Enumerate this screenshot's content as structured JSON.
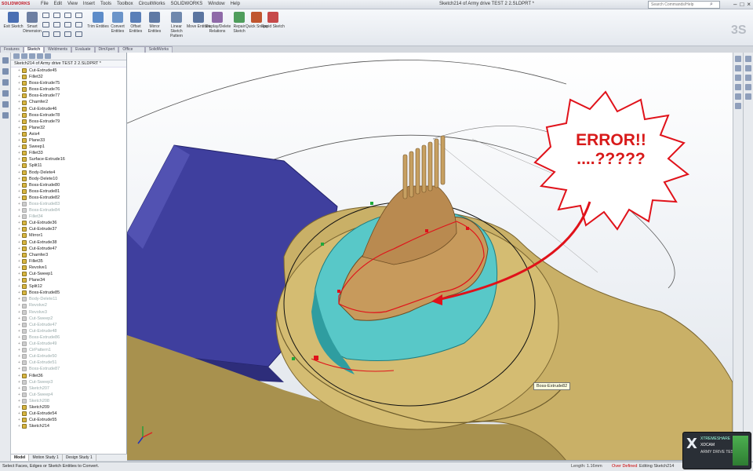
{
  "app": {
    "brand": "SOLIDWORKS",
    "window_title": "Sketch214 of Army drive TEST 2 2.SLDPRT *",
    "search_placeholder": "Search Commands/Help",
    "menu": [
      "File",
      "Edit",
      "View",
      "Insert",
      "Tools",
      "Toolbox",
      "CircuitWorks",
      "SOLIDWORKS",
      "Window",
      "Help"
    ]
  },
  "ribbon": {
    "buttons": [
      {
        "label": "Exit Sketch",
        "color": "#4a6fb3"
      },
      {
        "label": "Smart Dimension",
        "color": "#6d7fa2"
      },
      {
        "label": "Trim Entities",
        "color": "#5d8cc9"
      },
      {
        "label": "Convert Entities",
        "color": "#6b94c9"
      },
      {
        "label": "Offset Entities",
        "color": "#5a7fb8"
      },
      {
        "label": "Mirror Entities",
        "color": "#5f7aa5"
      },
      {
        "label": "Linear Sketch Pattern",
        "color": "#6f88ad"
      },
      {
        "label": "Move Entities",
        "color": "#5b75a0"
      },
      {
        "label": "Display/Delete Relations",
        "color": "#8f6aa8"
      },
      {
        "label": "Repair Sketch",
        "color": "#4f9d5c"
      },
      {
        "label": "Quick Snaps",
        "color": "#c0562f"
      },
      {
        "label": "Rapid Sketch",
        "color": "#c64a4a"
      }
    ],
    "tabs": [
      "Features",
      "Sketch",
      "Weldments",
      "Evaluate",
      "DimXpert",
      "Office Products",
      "SolidWorks"
    ],
    "active_tab": "Sketch"
  },
  "tree": {
    "root": "Sketch214 of Army drive TEST 2 2.SLDPRT *",
    "items": [
      {
        "label": "Cut-Extrude45",
        "suppressed": false
      },
      {
        "label": "Fillet32",
        "suppressed": false
      },
      {
        "label": "Boss-Extrude75",
        "suppressed": false
      },
      {
        "label": "Boss-Extrude76",
        "suppressed": false
      },
      {
        "label": "Boss-Extrude77",
        "suppressed": false
      },
      {
        "label": "Chamfer2",
        "suppressed": false
      },
      {
        "label": "Cut-Extrude46",
        "suppressed": false
      },
      {
        "label": "Boss-Extrude78",
        "suppressed": false
      },
      {
        "label": "Boss-Extrude79",
        "suppressed": false
      },
      {
        "label": "Plane32",
        "suppressed": false
      },
      {
        "label": "Axis4",
        "suppressed": false
      },
      {
        "label": "Plane33",
        "suppressed": false
      },
      {
        "label": "Sweep1",
        "suppressed": false
      },
      {
        "label": "Fillet33",
        "suppressed": false
      },
      {
        "label": "Surface-Extrude16",
        "suppressed": false
      },
      {
        "label": "Split11",
        "suppressed": false
      },
      {
        "label": "Body-Delete4",
        "suppressed": false
      },
      {
        "label": "Body-Delete10",
        "suppressed": false
      },
      {
        "label": "Boss-Extrude80",
        "suppressed": false
      },
      {
        "label": "Boss-Extrude81",
        "suppressed": false
      },
      {
        "label": "Boss-Extrude82",
        "suppressed": false
      },
      {
        "label": "Boss-Extrude83",
        "suppressed": true
      },
      {
        "label": "Boss-Extrude84",
        "suppressed": true
      },
      {
        "label": "Fillet34",
        "suppressed": true
      },
      {
        "label": "Cut-Extrude36",
        "suppressed": false
      },
      {
        "label": "Cut-Extrude37",
        "suppressed": false
      },
      {
        "label": "Mirror1",
        "suppressed": false
      },
      {
        "label": "Cut-Extrude38",
        "suppressed": false
      },
      {
        "label": "Cut-Extrude47",
        "suppressed": false
      },
      {
        "label": "Chamfer3",
        "suppressed": false
      },
      {
        "label": "Fillet35",
        "suppressed": false
      },
      {
        "label": "Revolve1",
        "suppressed": false
      },
      {
        "label": "Cut-Sweep1",
        "suppressed": false
      },
      {
        "label": "Plane34",
        "suppressed": false
      },
      {
        "label": "Split12",
        "suppressed": false
      },
      {
        "label": "Boss-Extrude85",
        "suppressed": false
      },
      {
        "label": "Body-Delete11",
        "suppressed": true
      },
      {
        "label": "Revolve2",
        "suppressed": true
      },
      {
        "label": "Revolve3",
        "suppressed": true
      },
      {
        "label": "Cut-Sweep2",
        "suppressed": true
      },
      {
        "label": "Cut-Extrude47",
        "suppressed": true
      },
      {
        "label": "Cut-Extrude48",
        "suppressed": true
      },
      {
        "label": "Boss-Extrude86",
        "suppressed": true
      },
      {
        "label": "Cut-Extrude49",
        "suppressed": true
      },
      {
        "label": "CirPattern1",
        "suppressed": true
      },
      {
        "label": "Cut-Extrude50",
        "suppressed": true
      },
      {
        "label": "Cut-Extrude51",
        "suppressed": true
      },
      {
        "label": "Boss-Extrude87",
        "suppressed": true
      },
      {
        "label": "Fillet36",
        "suppressed": false
      },
      {
        "label": "Cut-Sweep3",
        "suppressed": true
      },
      {
        "label": "Sketch207",
        "suppressed": true
      },
      {
        "label": "Cut-Sweep4",
        "suppressed": true
      },
      {
        "label": "Sketch208",
        "suppressed": true
      },
      {
        "label": "Sketch209",
        "suppressed": false
      },
      {
        "label": "Cut-Extrude54",
        "suppressed": false
      },
      {
        "label": "Cut-Extrude55",
        "suppressed": false
      },
      {
        "label": "Sketch214",
        "suppressed": false
      }
    ],
    "bottom_tabs": [
      "Model",
      "Motion Study 1",
      "Design Study 1"
    ]
  },
  "viewport": {
    "callout_line1": "ERROR!!",
    "callout_line2": "....?????",
    "tooltip": "Boss-Extrude82",
    "colors": {
      "body_gold": "#c9b067",
      "body_gold_dark": "#a8914e",
      "blue_part": "#3f3f9e",
      "cyan_cut": "#58c8c8",
      "tan_top": "#c79a5c",
      "error_red": "#e0121a"
    }
  },
  "status": {
    "left": "Select Faces, Edges or Sketch Entities to Convert.",
    "length": "Length: 1.16mm",
    "overdefined": "Over Defined",
    "editing": "Editing Sketch214"
  },
  "badge": {
    "line1": "XTREMESHARE",
    "line2": "XDCAM",
    "line3": "ARMY DRIVE TEST"
  }
}
